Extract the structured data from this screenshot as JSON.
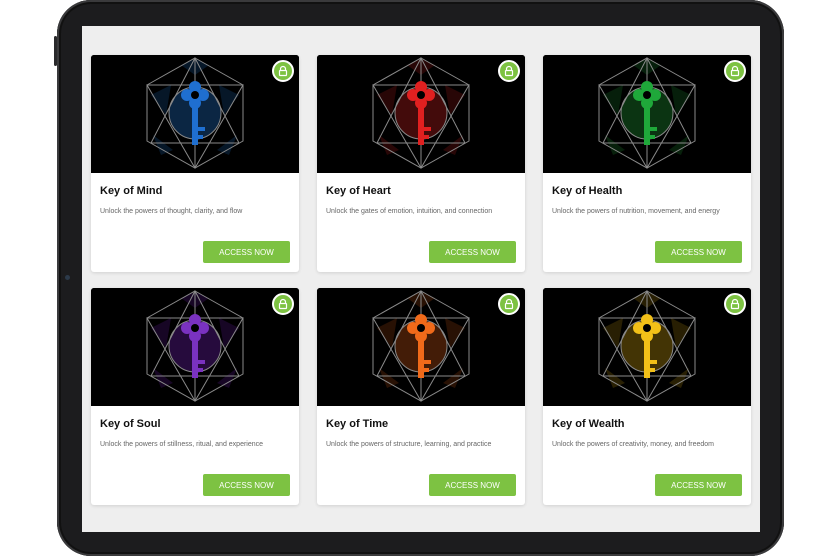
{
  "colors": {
    "accent": "#7dc242",
    "card_bg": "#ffffff",
    "screen_bg": "#eeeeee"
  },
  "cards": [
    {
      "title": "Key of Mind",
      "description": "Unlock the powers of thought, clarity, and flow",
      "button": "ACCESS NOW",
      "key_color": "#1f6fd0",
      "glow": "#0c2a4a",
      "icon": "lock-icon"
    },
    {
      "title": "Key of Heart",
      "description": "Unlock the gates of emotion, intuition, and connection",
      "button": "ACCESS NOW",
      "key_color": "#e02020",
      "glow": "#4a0c0c",
      "icon": "lock-icon"
    },
    {
      "title": "Key of Health",
      "description": "Unlock the powers of nutrition, movement, and energy",
      "button": "ACCESS NOW",
      "key_color": "#1fa83a",
      "glow": "#0c3a14",
      "icon": "lock-icon"
    },
    {
      "title": "Key of Soul",
      "description": "Unlock the powers of stillness, ritual, and experience",
      "button": "ACCESS NOW",
      "key_color": "#7a32c0",
      "glow": "#2a0c44",
      "icon": "lock-icon"
    },
    {
      "title": "Key of Time",
      "description": "Unlock the powers of structure, learning, and practice",
      "button": "ACCESS NOW",
      "key_color": "#f06a1a",
      "glow": "#4a1f08",
      "icon": "lock-icon"
    },
    {
      "title": "Key of Wealth",
      "description": "Unlock the powers of creativity, money, and freedom",
      "button": "ACCESS NOW",
      "key_color": "#f2c018",
      "glow": "#4a3a06",
      "icon": "lock-icon"
    }
  ]
}
